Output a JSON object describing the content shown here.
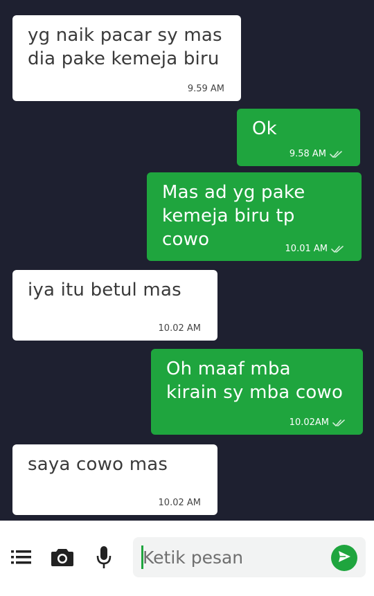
{
  "colors": {
    "background": "#1e2030",
    "incoming_bubble": "#ffffff",
    "outgoing_bubble": "#1fa53e",
    "accent": "#1fa53e"
  },
  "messages": [
    {
      "direction": "incoming",
      "text": "yg naik pacar sy mas\ndia pake kemeja biru",
      "time": "9.59 AM"
    },
    {
      "direction": "outgoing",
      "text": "Ok",
      "time": "9.58 AM",
      "status": "double-check-icon"
    },
    {
      "direction": "outgoing",
      "text": "Mas ad yg pake\nkemeja biru tp cowo",
      "time": "10.01 AM",
      "status": "double-check-icon"
    },
    {
      "direction": "incoming",
      "text": "iya itu betul mas",
      "time": "10.02 AM"
    },
    {
      "direction": "outgoing",
      "text": "Oh maaf mba\nkirain sy mba cowo",
      "time": "10.02AM",
      "status": "double-check-icon"
    },
    {
      "direction": "incoming",
      "text": "saya cowo mas",
      "time": "10.02 AM"
    }
  ],
  "composer": {
    "placeholder": "Ketik pesan",
    "value": "",
    "icons": [
      "menu-icon",
      "camera-icon",
      "mic-icon",
      "send-icon"
    ]
  }
}
